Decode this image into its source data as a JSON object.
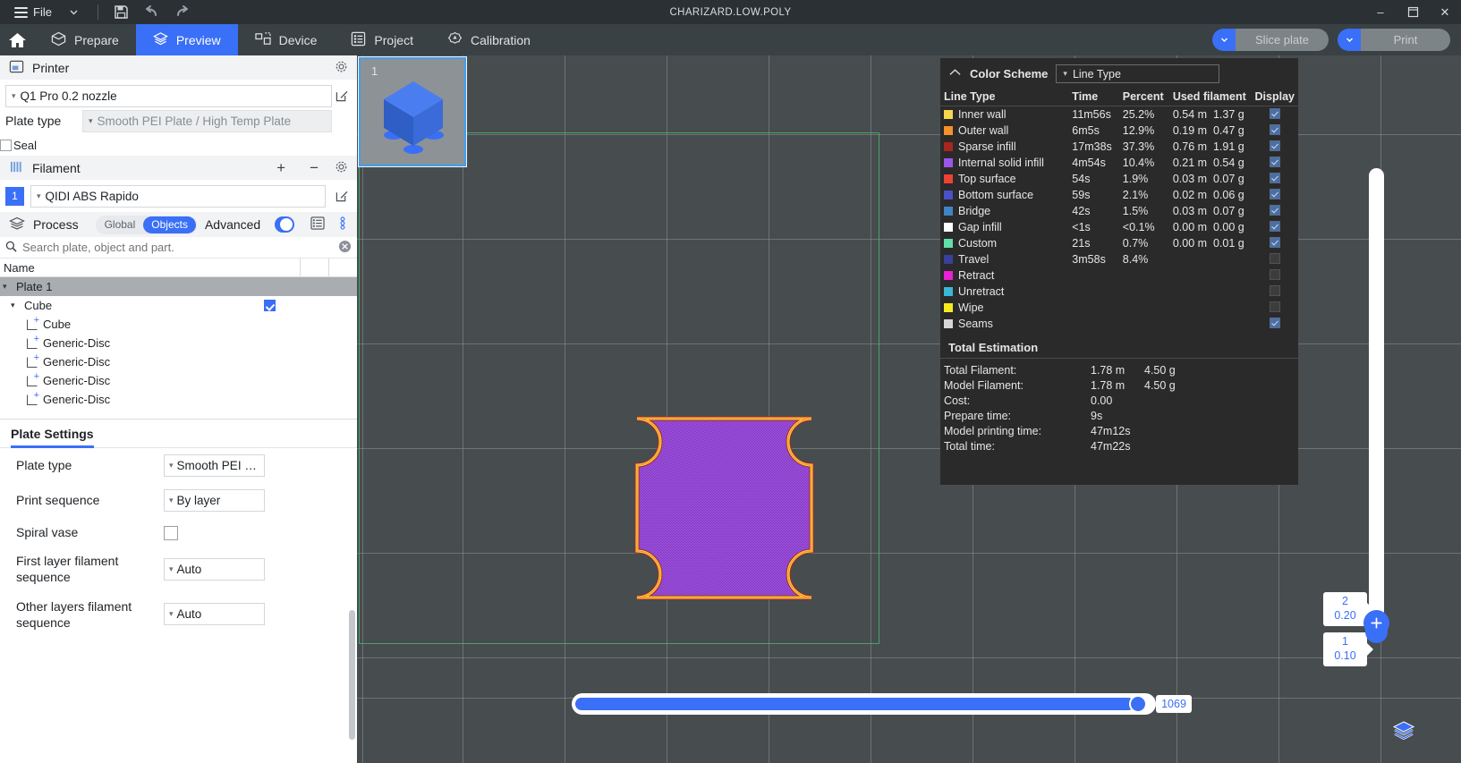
{
  "titlebar": {
    "file_label": "File",
    "project_name": "CHARIZARD.LOW.POLY",
    "icons": [
      "hamburger-icon",
      "chevron-down-icon",
      "save-icon",
      "undo-icon",
      "redo-icon"
    ],
    "minimize": "–",
    "maximize": "☐",
    "close": "✕"
  },
  "topnav": {
    "home_icon": "home-icon",
    "items": [
      {
        "label": "Prepare",
        "icon": "box-icon",
        "active": false
      },
      {
        "label": "Preview",
        "icon": "layers-icon",
        "active": true
      },
      {
        "label": "Device",
        "icon": "device-icon",
        "active": false
      },
      {
        "label": "Project",
        "icon": "list-icon",
        "active": false
      },
      {
        "label": "Calibration",
        "icon": "target-icon",
        "active": false
      }
    ],
    "slice_plate_label": "Slice plate",
    "print_label": "Print",
    "accent": "#3a6ff7"
  },
  "printer": {
    "section_title": "Printer",
    "preset": "Q1 Pro 0.2 nozzle",
    "plate_type_label": "Plate type",
    "plate_type_value": "Smooth PEI Plate / High Temp Plate",
    "seal_label": "Seal",
    "seal_checked": false
  },
  "filament": {
    "section_title": "Filament",
    "add_label": "+",
    "remove_label": "−",
    "index": "1",
    "preset": "QIDI ABS Rapido"
  },
  "process": {
    "section_title": "Process",
    "scope_global": "Global",
    "scope_objects": "Objects",
    "scope_selected": "Objects",
    "advanced_label": "Advanced",
    "advanced_on": true
  },
  "objects": {
    "search_placeholder": "Search plate, object and part.",
    "column_name": "Name",
    "tree": [
      {
        "label": "Plate 1",
        "level": "plate",
        "expanded": true,
        "checked": null
      },
      {
        "label": "Cube",
        "level": "obj",
        "expanded": true,
        "checked": true
      },
      {
        "label": "Cube",
        "level": "part"
      },
      {
        "label": "Generic-Disc",
        "level": "part"
      },
      {
        "label": "Generic-Disc",
        "level": "part"
      },
      {
        "label": "Generic-Disc",
        "level": "part"
      },
      {
        "label": "Generic-Disc",
        "level": "part"
      }
    ]
  },
  "plate_settings": {
    "title": "Plate Settings",
    "rows": [
      {
        "label": "Plate type",
        "value": "Smooth PEI …",
        "type": "combo"
      },
      {
        "label": "Print sequence",
        "value": "By layer",
        "type": "combo"
      },
      {
        "label": "Spiral vase",
        "value": "",
        "type": "checkbox",
        "checked": false
      },
      {
        "label": "First layer filament sequence",
        "value": "Auto",
        "type": "combo"
      },
      {
        "label": "Other layers filament sequence",
        "value": "Auto",
        "type": "combo"
      }
    ]
  },
  "viewport": {
    "plate_thumbnail_number": "1",
    "bed_outline_color": "#49b36a",
    "background": "#474c4f"
  },
  "color_scheme": {
    "collapse_icon": "chevron-up-icon",
    "title": "Color Scheme",
    "mode": "Line Type",
    "columns": [
      "Line Type",
      "Time",
      "Percent",
      "Used filament",
      "Display"
    ],
    "rows": [
      {
        "name": "Inner wall",
        "color": "#f5d64e",
        "time": "11m56s",
        "percent": "25.2%",
        "length": "0.54 m",
        "weight": "1.37 g",
        "display": true
      },
      {
        "name": "Outer wall",
        "color": "#f5912a",
        "time": "6m5s",
        "percent": "12.9%",
        "length": "0.19 m",
        "weight": "0.47 g",
        "display": true
      },
      {
        "name": "Sparse infill",
        "color": "#a8261f",
        "time": "17m38s",
        "percent": "37.3%",
        "length": "0.76 m",
        "weight": "1.91 g",
        "display": true
      },
      {
        "name": "Internal solid infill",
        "color": "#9b56e8",
        "time": "4m54s",
        "percent": "10.4%",
        "length": "0.21 m",
        "weight": "0.54 g",
        "display": true
      },
      {
        "name": "Top surface",
        "color": "#ee4136",
        "time": "54s",
        "percent": "1.9%",
        "length": "0.03 m",
        "weight": "0.07 g",
        "display": true
      },
      {
        "name": "Bottom surface",
        "color": "#4a51c4",
        "time": "59s",
        "percent": "2.1%",
        "length": "0.02 m",
        "weight": "0.06 g",
        "display": true
      },
      {
        "name": "Bridge",
        "color": "#3f84c4",
        "time": "42s",
        "percent": "1.5%",
        "length": "0.03 m",
        "weight": "0.07 g",
        "display": true
      },
      {
        "name": "Gap infill",
        "color": "#ffffff",
        "time": "<1s",
        "percent": "<0.1%",
        "length": "0.00 m",
        "weight": "0.00 g",
        "display": true
      },
      {
        "name": "Custom",
        "color": "#61dfa8",
        "time": "21s",
        "percent": "0.7%",
        "length": "0.00 m",
        "weight": "0.01 g",
        "display": true
      },
      {
        "name": "Travel",
        "color": "#38409a",
        "time": "3m58s",
        "percent": "8.4%",
        "length": "",
        "weight": "",
        "display": false
      },
      {
        "name": "Retract",
        "color": "#e820d6",
        "time": "",
        "percent": "",
        "length": "",
        "weight": "",
        "display": false
      },
      {
        "name": "Unretract",
        "color": "#3bb6d6",
        "time": "",
        "percent": "",
        "length": "",
        "weight": "",
        "display": false
      },
      {
        "name": "Wipe",
        "color": "#f5ec1f",
        "time": "",
        "percent": "",
        "length": "",
        "weight": "",
        "display": false
      },
      {
        "name": "Seams",
        "color": "#d6d6d6",
        "time": "",
        "percent": "",
        "length": "",
        "weight": "",
        "display": true
      }
    ],
    "total_title": "Total Estimation",
    "totals": [
      {
        "label": "Total Filament:",
        "v1": "1.78 m",
        "v2": "4.50 g"
      },
      {
        "label": "Model Filament:",
        "v1": "1.78 m",
        "v2": "4.50 g"
      },
      {
        "label": "Cost:",
        "v1": "0.00",
        "v2": ""
      },
      {
        "label": "Prepare time:",
        "v1": "9s",
        "v2": ""
      },
      {
        "label": "Model printing time:",
        "v1": "47m12s",
        "v2": ""
      },
      {
        "label": "Total time:",
        "v1": "47m22s",
        "v2": ""
      }
    ]
  },
  "horizontal_slider": {
    "value": "1069",
    "percent": 96
  },
  "vertical_slider": {
    "upper_tip_layer": "2",
    "upper_tip_height": "0.20",
    "lower_tip_layer": "1",
    "lower_tip_height": "0.10",
    "plus_label": "+"
  },
  "bottom_right": {
    "layers_icon": "layers-icon"
  }
}
